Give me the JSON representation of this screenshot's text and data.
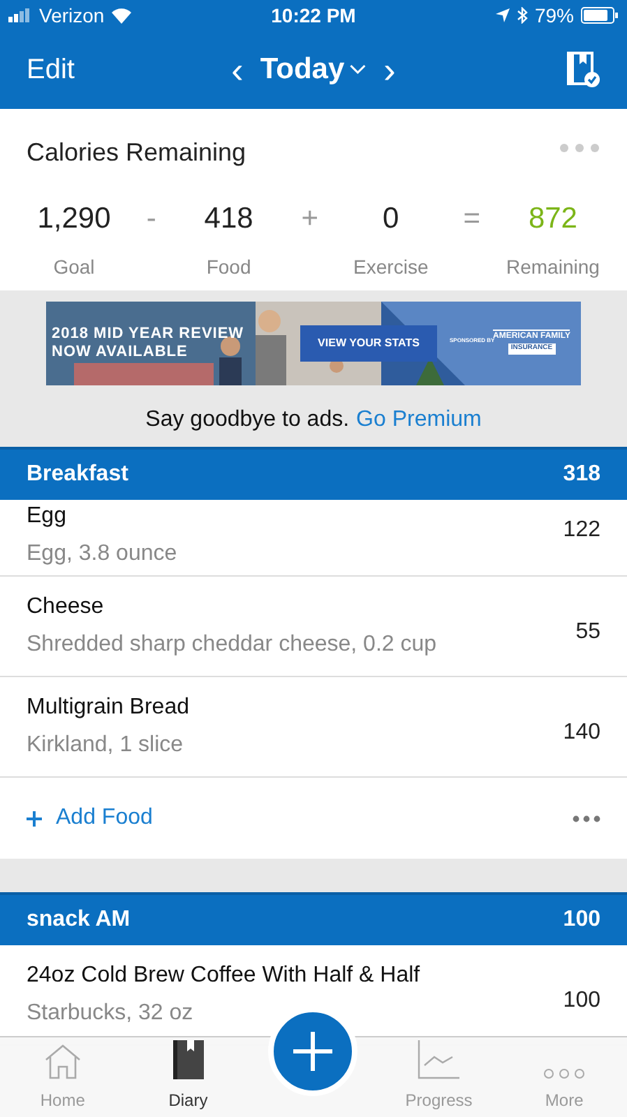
{
  "status_bar": {
    "carrier": "Verizon",
    "time": "10:22 PM",
    "battery": "79%"
  },
  "nav": {
    "edit": "Edit",
    "prev": "‹",
    "title": "Today",
    "next": "›"
  },
  "summary": {
    "title": "Calories Remaining",
    "items": [
      {
        "value": "1,290",
        "label": "Goal",
        "kind": "plain"
      },
      {
        "value": "418",
        "label": "Food",
        "kind": "plain"
      },
      {
        "value": "0",
        "label": "Exercise",
        "kind": "plain"
      },
      {
        "value": "872",
        "label": "Remaining",
        "kind": "result"
      }
    ],
    "operators": [
      "-",
      "+",
      "="
    ]
  },
  "ad": {
    "headline_1": "2018 MID YEAR REVIEW",
    "headline_2": "NOW AVAILABLE",
    "cta": "VIEW YOUR STATS",
    "sponsor": "SPONSORED BY",
    "brand_1": "AMERICAN FAMILY",
    "brand_2": "INSURANCE",
    "note": "Say goodbye to ads.",
    "link": "Go Premium"
  },
  "meals": [
    {
      "name": "Breakfast",
      "total": "318",
      "entries": [
        {
          "name": "Egg",
          "detail": "Egg, 3.8 ounce",
          "calories": "122"
        },
        {
          "name": "Cheese",
          "detail": "Shredded sharp cheddar cheese, 0.2 cup",
          "calories": "55"
        },
        {
          "name": "Multigrain Bread",
          "detail": "Kirkland, 1 slice",
          "calories": "140"
        }
      ],
      "add": "Add Food"
    },
    {
      "name": "snack AM",
      "total": "100",
      "entries": [
        {
          "name": "24oz Cold Brew Coffee With Half & Half",
          "detail": "Starbucks, 32 oz",
          "calories": "100"
        }
      ]
    }
  ],
  "tab_bar": [
    {
      "label": "Home",
      "kind": "home",
      "selected": false
    },
    {
      "label": "Diary",
      "kind": "diary",
      "selected": true
    },
    {
      "kind": "add",
      "selected": false
    },
    {
      "label": "Progress",
      "kind": "progress",
      "selected": false
    },
    {
      "label": "More",
      "kind": "more",
      "selected": false
    }
  ]
}
